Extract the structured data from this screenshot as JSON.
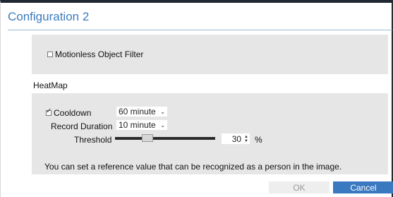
{
  "dialog": {
    "title": "Configuration 2",
    "title_color": "#3b7bbf"
  },
  "motionless": {
    "label": "Motionless Object Filter",
    "checked": false
  },
  "heatmap": {
    "section_label": "HeatMap",
    "cooldown": {
      "label": "Cooldown",
      "checked": true,
      "value": "60 minute"
    },
    "record_duration": {
      "label": "Record Duration",
      "value": "10 minute"
    },
    "threshold": {
      "label": "Threshold",
      "value": "30",
      "unit": "%",
      "slider_fraction": 0.3
    },
    "info_text": "You can set a reference value that can be recognized as a person in the image."
  },
  "buttons": {
    "ok_label": "OK",
    "cancel_label": "Cancel",
    "cancel_color": "#3a78c0"
  }
}
